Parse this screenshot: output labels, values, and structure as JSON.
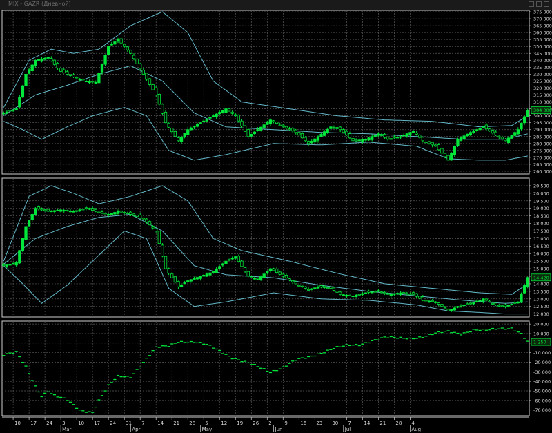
{
  "window": {
    "title": "MIX - GAZR (Дневной)"
  },
  "theme": {
    "up_color": "#00e63a",
    "down_color": "#00e63a",
    "band_color": "#63b8c8",
    "grid_color": "#5a5a5a",
    "bg": "#000000",
    "text": "#d8d8d8"
  },
  "chart_data": [
    {
      "type": "candlestick",
      "pane": "top",
      "ylim": [
        258000,
        376000
      ],
      "yticks": [
        260000,
        265000,
        270000,
        275000,
        280000,
        285000,
        290000,
        295000,
        300000,
        305000,
        310000,
        315000,
        320000,
        325000,
        330000,
        335000,
        340000,
        345000,
        350000,
        355000,
        360000,
        365000,
        370000,
        375000
      ],
      "ytick_labels": [
        "260 000",
        "265 000",
        "270 000",
        "275 000",
        "280 000",
        "285 000",
        "290 000",
        "295 000",
        "300 000",
        "305 000",
        "310 000",
        "315 000",
        "320 000",
        "325 000",
        "330 000",
        "335 000",
        "340 000",
        "345 000",
        "350 000",
        "355 000",
        "360 000",
        "365 000",
        "370 000",
        "375 000"
      ],
      "last_value": "304 000",
      "anchors": [
        [
          0,
          302000
        ],
        [
          4,
          305000
        ],
        [
          7,
          330000
        ],
        [
          10,
          340000
        ],
        [
          14,
          342000
        ],
        [
          18,
          332000
        ],
        [
          22,
          328000
        ],
        [
          26,
          325000
        ],
        [
          29,
          324000
        ],
        [
          33,
          350000
        ],
        [
          36,
          355000
        ],
        [
          40,
          345000
        ],
        [
          44,
          330000
        ],
        [
          48,
          315000
        ],
        [
          51,
          295000
        ],
        [
          55,
          282000
        ],
        [
          58,
          290000
        ],
        [
          62,
          295000
        ],
        [
          66,
          300000
        ],
        [
          70,
          305000
        ],
        [
          73,
          300000
        ],
        [
          77,
          285000
        ],
        [
          80,
          290000
        ],
        [
          84,
          297000
        ],
        [
          88,
          292000
        ],
        [
          92,
          288000
        ],
        [
          96,
          280000
        ],
        [
          99,
          285000
        ],
        [
          103,
          292000
        ],
        [
          106,
          290000
        ],
        [
          110,
          282000
        ],
        [
          114,
          283000
        ],
        [
          118,
          287000
        ],
        [
          121,
          283000
        ],
        [
          125,
          285000
        ],
        [
          129,
          289000
        ],
        [
          132,
          282000
        ],
        [
          136,
          278000
        ],
        [
          140,
          268000
        ],
        [
          143,
          283000
        ],
        [
          147,
          288000
        ],
        [
          151,
          292000
        ],
        [
          155,
          286000
        ],
        [
          158,
          282000
        ],
        [
          162,
          290000
        ],
        [
          165,
          304000
        ]
      ],
      "band_upper": [
        [
          0,
          306000
        ],
        [
          8,
          340000
        ],
        [
          15,
          348000
        ],
        [
          22,
          345000
        ],
        [
          30,
          348000
        ],
        [
          40,
          365000
        ],
        [
          50,
          375000
        ],
        [
          58,
          360000
        ],
        [
          66,
          325000
        ],
        [
          75,
          310000
        ],
        [
          90,
          305000
        ],
        [
          105,
          300000
        ],
        [
          120,
          297000
        ],
        [
          135,
          296000
        ],
        [
          150,
          292000
        ],
        [
          160,
          293000
        ],
        [
          165,
          300000
        ]
      ],
      "band_lower": [
        [
          0,
          296000
        ],
        [
          6,
          290000
        ],
        [
          12,
          283000
        ],
        [
          20,
          292000
        ],
        [
          28,
          300000
        ],
        [
          38,
          306000
        ],
        [
          45,
          300000
        ],
        [
          52,
          275000
        ],
        [
          60,
          268000
        ],
        [
          70,
          272000
        ],
        [
          85,
          280000
        ],
        [
          100,
          279000
        ],
        [
          115,
          281000
        ],
        [
          130,
          278000
        ],
        [
          140,
          269000
        ],
        [
          150,
          268000
        ],
        [
          158,
          268000
        ],
        [
          165,
          271000
        ]
      ],
      "band_middle": [
        [
          0,
          300000
        ],
        [
          10,
          315000
        ],
        [
          20,
          322000
        ],
        [
          30,
          330000
        ],
        [
          40,
          336000
        ],
        [
          50,
          325000
        ],
        [
          60,
          302000
        ],
        [
          70,
          292000
        ],
        [
          85,
          290000
        ],
        [
          100,
          288000
        ],
        [
          115,
          287000
        ],
        [
          130,
          285000
        ],
        [
          145,
          283000
        ],
        [
          158,
          283000
        ],
        [
          165,
          287000
        ]
      ]
    },
    {
      "type": "candlestick",
      "pane": "middle",
      "ylim": [
        11800,
        21000
      ],
      "yticks": [
        12000,
        12500,
        13000,
        13500,
        14000,
        14500,
        15000,
        15500,
        16000,
        16500,
        17000,
        17500,
        18000,
        18500,
        19000,
        19500,
        20000,
        20500
      ],
      "ytick_labels": [
        "12 000",
        "12 500",
        "13 000",
        "13 500",
        "14 000",
        "14 500",
        "15 000",
        "15 500",
        "16 000",
        "16 500",
        "17 000",
        "17 500",
        "18 000",
        "18 500",
        "19 000",
        "19 500",
        "20 000",
        "20 500"
      ],
      "last_value": "14 420",
      "anchors": [
        [
          0,
          15200
        ],
        [
          4,
          15400
        ],
        [
          7,
          17800
        ],
        [
          10,
          19000
        ],
        [
          14,
          18800
        ],
        [
          18,
          18900
        ],
        [
          22,
          18800
        ],
        [
          26,
          19000
        ],
        [
          29,
          18800
        ],
        [
          33,
          18600
        ],
        [
          36,
          18800
        ],
        [
          40,
          18600
        ],
        [
          44,
          18300
        ],
        [
          48,
          17500
        ],
        [
          51,
          15000
        ],
        [
          55,
          13800
        ],
        [
          58,
          14200
        ],
        [
          62,
          14500
        ],
        [
          66,
          14800
        ],
        [
          70,
          15500
        ],
        [
          73,
          15800
        ],
        [
          77,
          14500
        ],
        [
          80,
          14300
        ],
        [
          84,
          15000
        ],
        [
          88,
          14500
        ],
        [
          92,
          14000
        ],
        [
          96,
          13600
        ],
        [
          99,
          13800
        ],
        [
          103,
          13700
        ],
        [
          106,
          13300
        ],
        [
          110,
          13200
        ],
        [
          114,
          13400
        ],
        [
          118,
          13500
        ],
        [
          121,
          13300
        ],
        [
          125,
          13400
        ],
        [
          129,
          13300
        ],
        [
          132,
          12900
        ],
        [
          136,
          12800
        ],
        [
          140,
          12200
        ],
        [
          143,
          12500
        ],
        [
          147,
          12700
        ],
        [
          151,
          13000
        ],
        [
          155,
          12600
        ],
        [
          158,
          12500
        ],
        [
          162,
          12800
        ],
        [
          165,
          14420
        ]
      ],
      "band_upper": [
        [
          0,
          15500
        ],
        [
          8,
          19800
        ],
        [
          15,
          20500
        ],
        [
          22,
          20000
        ],
        [
          30,
          19300
        ],
        [
          40,
          19800
        ],
        [
          50,
          20500
        ],
        [
          58,
          19500
        ],
        [
          66,
          17000
        ],
        [
          75,
          16200
        ],
        [
          90,
          15500
        ],
        [
          105,
          14700
        ],
        [
          120,
          14000
        ],
        [
          135,
          13700
        ],
        [
          150,
          13400
        ],
        [
          160,
          13300
        ],
        [
          165,
          14000
        ]
      ],
      "band_lower": [
        [
          0,
          15200
        ],
        [
          6,
          14000
        ],
        [
          12,
          12700
        ],
        [
          20,
          13900
        ],
        [
          28,
          15500
        ],
        [
          38,
          17500
        ],
        [
          45,
          17000
        ],
        [
          52,
          13700
        ],
        [
          60,
          12500
        ],
        [
          70,
          12800
        ],
        [
          85,
          13400
        ],
        [
          100,
          13000
        ],
        [
          115,
          12900
        ],
        [
          130,
          12600
        ],
        [
          140,
          12200
        ],
        [
          150,
          12100
        ],
        [
          158,
          12000
        ],
        [
          165,
          12000
        ]
      ],
      "band_middle": [
        [
          0,
          15300
        ],
        [
          10,
          17000
        ],
        [
          20,
          17800
        ],
        [
          30,
          18400
        ],
        [
          40,
          18600
        ],
        [
          50,
          17500
        ],
        [
          60,
          15200
        ],
        [
          70,
          14600
        ],
        [
          85,
          14400
        ],
        [
          100,
          13900
        ],
        [
          115,
          13500
        ],
        [
          130,
          13200
        ],
        [
          145,
          12900
        ],
        [
          158,
          12700
        ],
        [
          165,
          12800
        ]
      ]
    },
    {
      "type": "scatter",
      "pane": "bottom",
      "marker": "dash",
      "ylim": [
        -76000,
        23000
      ],
      "yticks": [
        20000,
        10000,
        0,
        -10000,
        -20000,
        -30000,
        -40000,
        -50000,
        -60000,
        -70000
      ],
      "ytick_labels": [
        "20 000",
        "10 000",
        "0",
        "-10 000",
        "-20 000",
        "-30 000",
        "-40 000",
        "-50 000",
        "-60 000",
        "-70 000"
      ],
      "last_value": "1 250",
      "anchors": [
        [
          0,
          -12000
        ],
        [
          4,
          -10000
        ],
        [
          7,
          -25000
        ],
        [
          10,
          -45000
        ],
        [
          12,
          -55000
        ],
        [
          14,
          -50000
        ],
        [
          16,
          -55000
        ],
        [
          20,
          -60000
        ],
        [
          24,
          -70000
        ],
        [
          28,
          -72000
        ],
        [
          30,
          -60000
        ],
        [
          33,
          -45000
        ],
        [
          36,
          -35000
        ],
        [
          40,
          -35000
        ],
        [
          44,
          -20000
        ],
        [
          48,
          -5000
        ],
        [
          52,
          -3000
        ],
        [
          55,
          2000
        ],
        [
          60,
          1000
        ],
        [
          64,
          -2000
        ],
        [
          68,
          -8000
        ],
        [
          72,
          -15000
        ],
        [
          76,
          -20000
        ],
        [
          80,
          -25000
        ],
        [
          84,
          -30000
        ],
        [
          88,
          -25000
        ],
        [
          92,
          -18000
        ],
        [
          96,
          -15000
        ],
        [
          100,
          -10000
        ],
        [
          104,
          -5000
        ],
        [
          108,
          -3000
        ],
        [
          112,
          -2000
        ],
        [
          116,
          3000
        ],
        [
          120,
          6000
        ],
        [
          124,
          5000
        ],
        [
          128,
          5000
        ],
        [
          132,
          7000
        ],
        [
          136,
          10000
        ],
        [
          140,
          12000
        ],
        [
          144,
          10000
        ],
        [
          148,
          14000
        ],
        [
          152,
          13000
        ],
        [
          156,
          15000
        ],
        [
          160,
          16000
        ],
        [
          163,
          10000
        ],
        [
          165,
          1250
        ]
      ]
    }
  ],
  "x_axis": {
    "n_bars": 166,
    "day_ticks": [
      {
        "i": 3,
        "label": "10"
      },
      {
        "i": 8,
        "label": "17"
      },
      {
        "i": 13,
        "label": "24"
      },
      {
        "i": 18,
        "label": "3"
      },
      {
        "i": 23,
        "label": "10"
      },
      {
        "i": 28,
        "label": "17"
      },
      {
        "i": 33,
        "label": "24"
      },
      {
        "i": 38,
        "label": "31"
      },
      {
        "i": 43,
        "label": "7"
      },
      {
        "i": 48,
        "label": "14"
      },
      {
        "i": 53,
        "label": "21"
      },
      {
        "i": 58,
        "label": "28"
      },
      {
        "i": 63,
        "label": "5"
      },
      {
        "i": 68,
        "label": "12"
      },
      {
        "i": 73,
        "label": "19"
      },
      {
        "i": 78,
        "label": "26"
      },
      {
        "i": 83,
        "label": "2"
      },
      {
        "i": 88,
        "label": "9"
      },
      {
        "i": 93,
        "label": "16"
      },
      {
        "i": 98,
        "label": "23"
      },
      {
        "i": 103,
        "label": "30"
      },
      {
        "i": 108,
        "label": "7"
      },
      {
        "i": 113,
        "label": "14"
      },
      {
        "i": 118,
        "label": "21"
      },
      {
        "i": 123,
        "label": "28"
      },
      {
        "i": 128,
        "label": "4"
      }
    ],
    "month_ticks": [
      {
        "i": 18,
        "label": "Mar"
      },
      {
        "i": 40,
        "label": "Apr"
      },
      {
        "i": 62,
        "label": "May"
      },
      {
        "i": 85,
        "label": "Jun"
      },
      {
        "i": 107,
        "label": "Jul"
      },
      {
        "i": 128,
        "label": "Aug"
      }
    ]
  }
}
